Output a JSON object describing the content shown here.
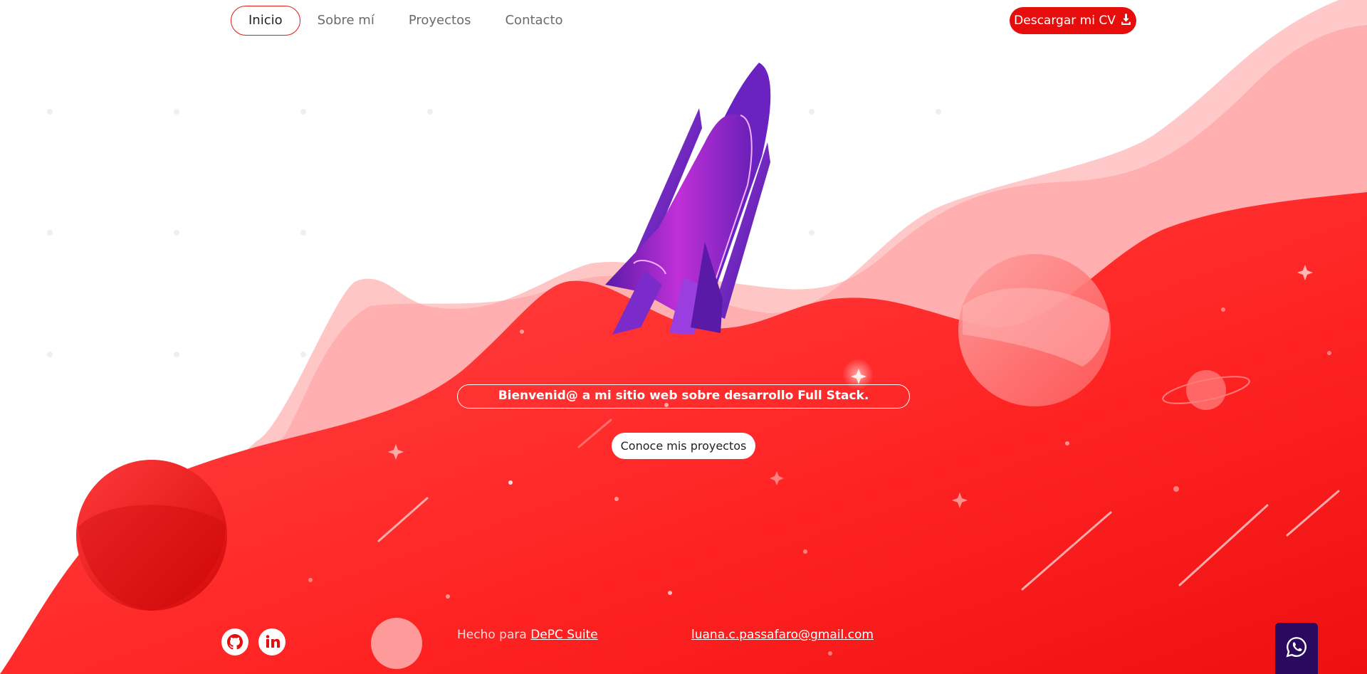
{
  "nav": {
    "items": [
      {
        "label": "Inicio",
        "active": true
      },
      {
        "label": "Sobre mí",
        "active": false
      },
      {
        "label": "Proyectos",
        "active": false
      },
      {
        "label": "Contacto",
        "active": false
      }
    ],
    "cv_button_label": "Descargar mi CV"
  },
  "hero": {
    "welcome_text": "Bienvenid@ a mi sitio web sobre desarrollo Full Stack.",
    "projects_button_label": "Conoce mis proyectos"
  },
  "footer": {
    "made_for_prefix": "Hecho para",
    "made_for_link": "DePC Suite",
    "email": "luana.c.passafaro@gmail.com"
  },
  "icons": {
    "social": [
      "github-icon",
      "linkedin-icon"
    ],
    "whatsapp": "whatsapp-icon",
    "download": "download-icon"
  },
  "colors": {
    "accent_red": "#e60d0d",
    "light_red": "#ffc4c4",
    "rocket_purple": "#7a2bc9",
    "whatsapp_bg": "#2a0a5e"
  }
}
